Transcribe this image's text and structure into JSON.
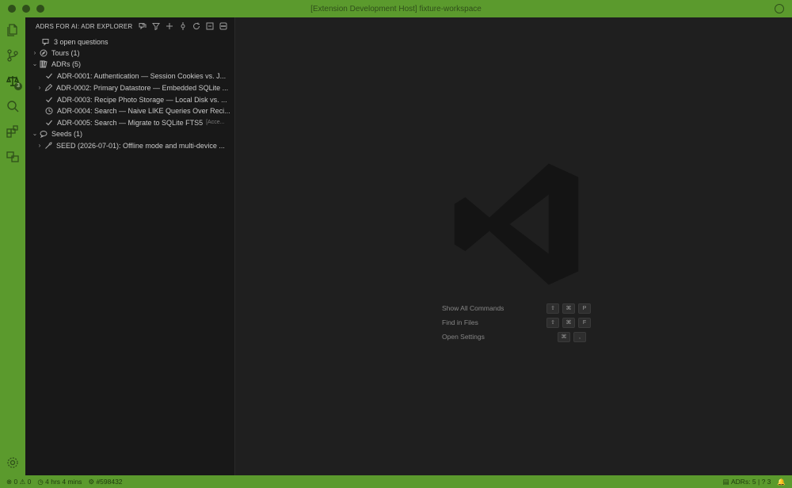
{
  "window": {
    "title": "[Extension Development Host] fixture-workspace"
  },
  "activity_bar": {
    "items": [
      {
        "name": "explorer-icon"
      },
      {
        "name": "source-control-icon"
      },
      {
        "name": "adr-explorer-icon",
        "badge": "3"
      },
      {
        "name": "search-icon"
      },
      {
        "name": "extensions-icon"
      },
      {
        "name": "remote-icon"
      }
    ],
    "bottom": {
      "name": "settings-gear-icon"
    }
  },
  "sidebar": {
    "header": "ADRS FOR AI: ADR EXPLORER",
    "actions": [
      "comment-discussion-icon",
      "filter-icon",
      "add-icon",
      "git-commit-icon",
      "refresh-icon",
      "collapse-icon",
      "ellipsis-icon"
    ],
    "open_questions": "3 open questions",
    "tours": "Tours (1)",
    "adrs": "ADRs (5)",
    "adr_items": [
      {
        "label": "ADR-0001: Authentication — Session Cookies vs. J...",
        "icon": "check-icon"
      },
      {
        "label": "ADR-0002: Primary Datastore — Embedded SQLite ...",
        "icon": "pencil-icon"
      },
      {
        "label": "ADR-0003: Recipe Photo Storage — Local Disk vs. ...",
        "icon": "check-icon"
      },
      {
        "label": "ADR-0004: Search — Naive LIKE Queries Over Reci...",
        "icon": "clock-icon"
      },
      {
        "label": "ADR-0005: Search — Migrate to SQLite FTS5",
        "icon": "check-icon",
        "status": "[Acce..."
      }
    ],
    "seeds": "Seeds (1)",
    "seed_item": "SEED (2026-07-01): Offline mode and multi-device ..."
  },
  "editor": {
    "shortcuts": [
      {
        "label": "Show All Commands",
        "keys": [
          "⇧",
          "⌘",
          "P"
        ]
      },
      {
        "label": "Find in Files",
        "keys": [
          "⇧",
          "⌘",
          "F"
        ]
      },
      {
        "label": "Open Settings",
        "keys": [
          "⌘",
          ","
        ]
      }
    ]
  },
  "statusbar": {
    "errors": "0",
    "warnings": "0",
    "time": "4 hrs 4 mins",
    "commit": "#598432",
    "adrs": "ADRs: 5 | ? 3"
  },
  "colors": {
    "accent": "#5b9a2d",
    "sidebar_bg": "#181818",
    "editor_bg": "#1f1f1f"
  }
}
